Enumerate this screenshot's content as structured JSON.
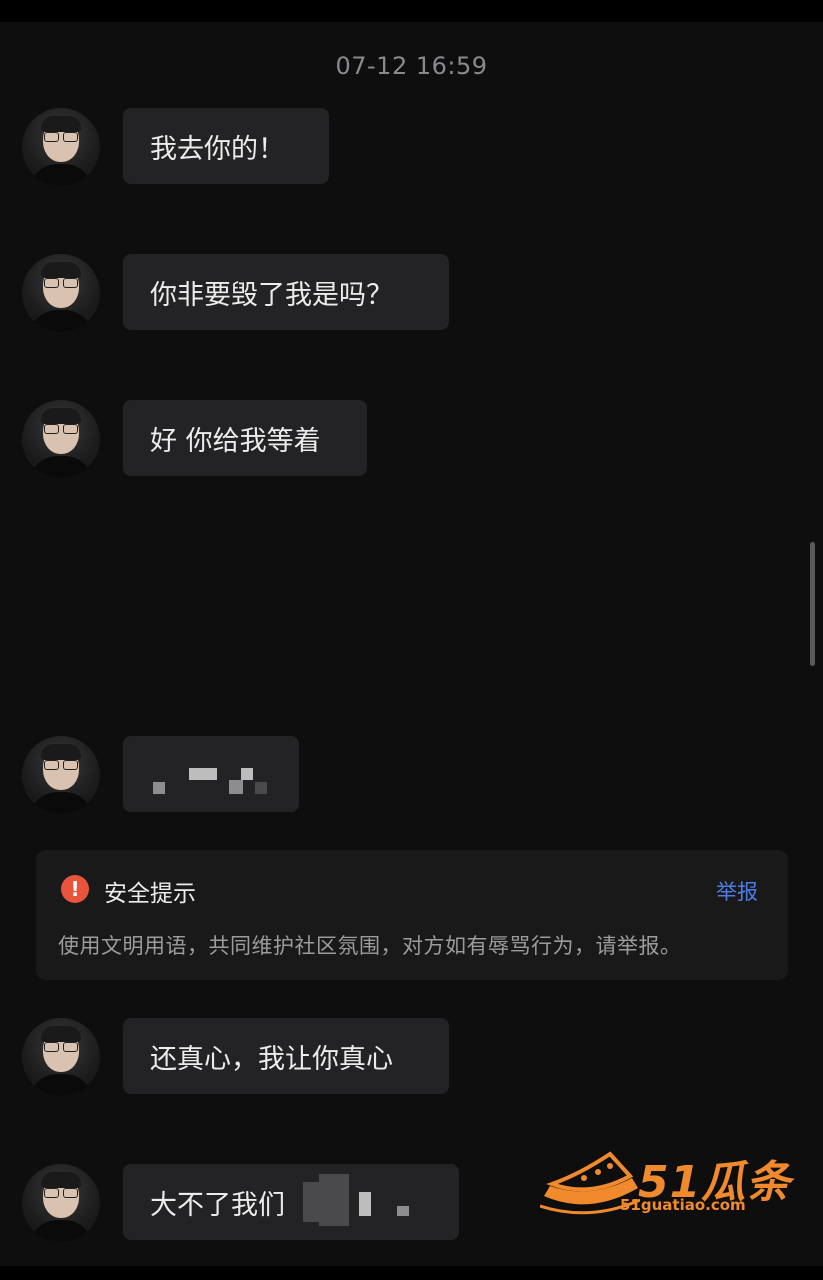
{
  "chat": {
    "timestamp": "07-12 16:59",
    "messages": [
      {
        "text": "我去你的！"
      },
      {
        "text": "你非要毁了我是吗？"
      },
      {
        "text": "好 你给我等着"
      },
      {
        "text": "",
        "censored": true
      },
      {
        "text": "还真心，我让你真心"
      },
      {
        "text": "大不了我们",
        "partially_censored": true
      }
    ]
  },
  "safety_notice": {
    "title": "安全提示",
    "report_label": "举报",
    "body": "使用文明用语，共同维护社区氛围，对方如有辱骂行为，请举报。",
    "icon": "exclamation-icon",
    "icon_color": "#e8553c",
    "report_color": "#4f7de6"
  },
  "watermark": {
    "brand": "51瓜条",
    "url": "51guatiao.com",
    "color": "#f08a2c"
  }
}
